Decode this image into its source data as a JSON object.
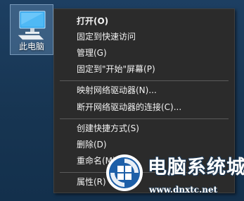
{
  "desktop": {
    "icon": {
      "label": "此电脑",
      "icon_name": "computer-icon"
    }
  },
  "context_menu": {
    "items": [
      {
        "label": "打开(O)",
        "bold": true
      },
      {
        "label": "固定到快速访问"
      },
      {
        "label": "管理(G)"
      },
      {
        "label": "固定到\"开始\"屏幕(P)"
      },
      {
        "label": "映射网络驱动器(N)..."
      },
      {
        "label": "断开网络驱动器的连接(C)..."
      },
      {
        "label": "创建快捷方式(S)"
      },
      {
        "label": "删除(D)"
      },
      {
        "label": "重命名(M)"
      },
      {
        "label": "属性(R)"
      }
    ]
  },
  "watermark": {
    "title": "电脑系统城",
    "url": "www.dnxtc.net",
    "logo_name": "watermark-logo-icon"
  },
  "colors": {
    "desktop_background": "#1b3a58",
    "menu_background": "#2b2b2b",
    "menu_text": "#f2f2f2",
    "separator": "#5a5a5a",
    "selection_highlight": "#7fa6cc"
  }
}
